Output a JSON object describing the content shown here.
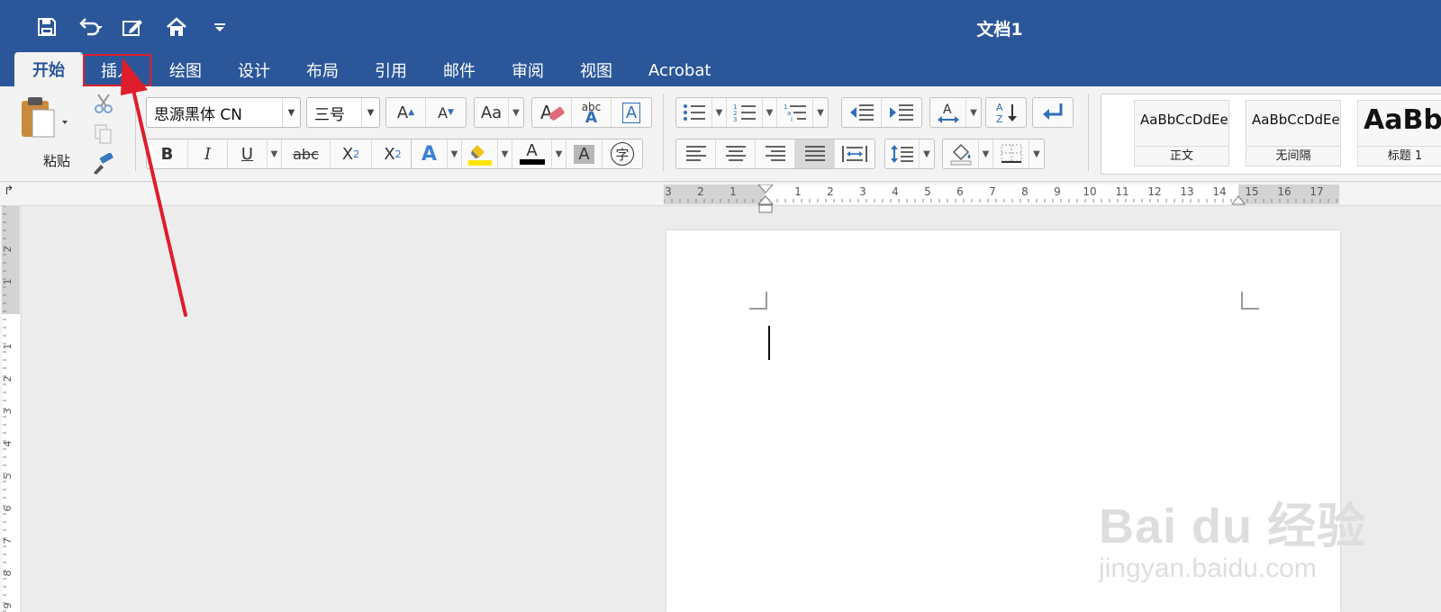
{
  "window": {
    "title": "文档1"
  },
  "quick_access": [
    {
      "icon": "save-icon"
    },
    {
      "icon": "undo-icon"
    },
    {
      "icon": "edit-icon"
    },
    {
      "icon": "home-icon"
    },
    {
      "icon": "customize-icon"
    }
  ],
  "tabs": [
    "开始",
    "插入",
    "绘图",
    "设计",
    "布局",
    "引用",
    "邮件",
    "审阅",
    "视图",
    "Acrobat"
  ],
  "active_tab": "开始",
  "highlighted_tab": "插入",
  "ribbon": {
    "paste_label": "粘贴",
    "font_name": "思源黑体 CN",
    "font_size": "三号",
    "grow": "A",
    "shrink": "A",
    "change_case": "Aa",
    "text_effects_abc": "abc",
    "bold": "B",
    "italic": "I",
    "underline": "U",
    "strike": "abc",
    "sub": "X",
    "sub_mark": "2",
    "sup": "X",
    "sup_mark": "2",
    "text_effect": "A",
    "font_color": "A",
    "char_shading": "A",
    "enclose": "字",
    "bullets": "≡",
    "sort_a": "A",
    "sort_z": "Z"
  },
  "styles": [
    {
      "sample": "AaBbCcDdEe",
      "name": "正文"
    },
    {
      "sample": "AaBbCcDdEe",
      "name": "无间隔"
    },
    {
      "sample": "AaBbC",
      "name": "标题 1"
    }
  ],
  "hruler_numbers": [
    "3",
    "2",
    "1",
    "1",
    "2",
    "3",
    "4",
    "5",
    "6",
    "7",
    "8",
    "9",
    "10",
    "11",
    "12",
    "13",
    "14",
    "15",
    "16",
    "17"
  ],
  "vruler_numbers": [
    "2",
    "1",
    "1",
    "2",
    "3",
    "4",
    "5",
    "6",
    "7",
    "8",
    "9"
  ],
  "colors": {
    "title_bar": "#2b579a",
    "highlight_box": "#e01d2a",
    "annotation_arrow": "#e01d2a",
    "highlighter": "#ffe600",
    "font_color": "#000000"
  },
  "watermark": {
    "main": "Bai du 经验",
    "sub": "jingyan.baidu.com"
  }
}
